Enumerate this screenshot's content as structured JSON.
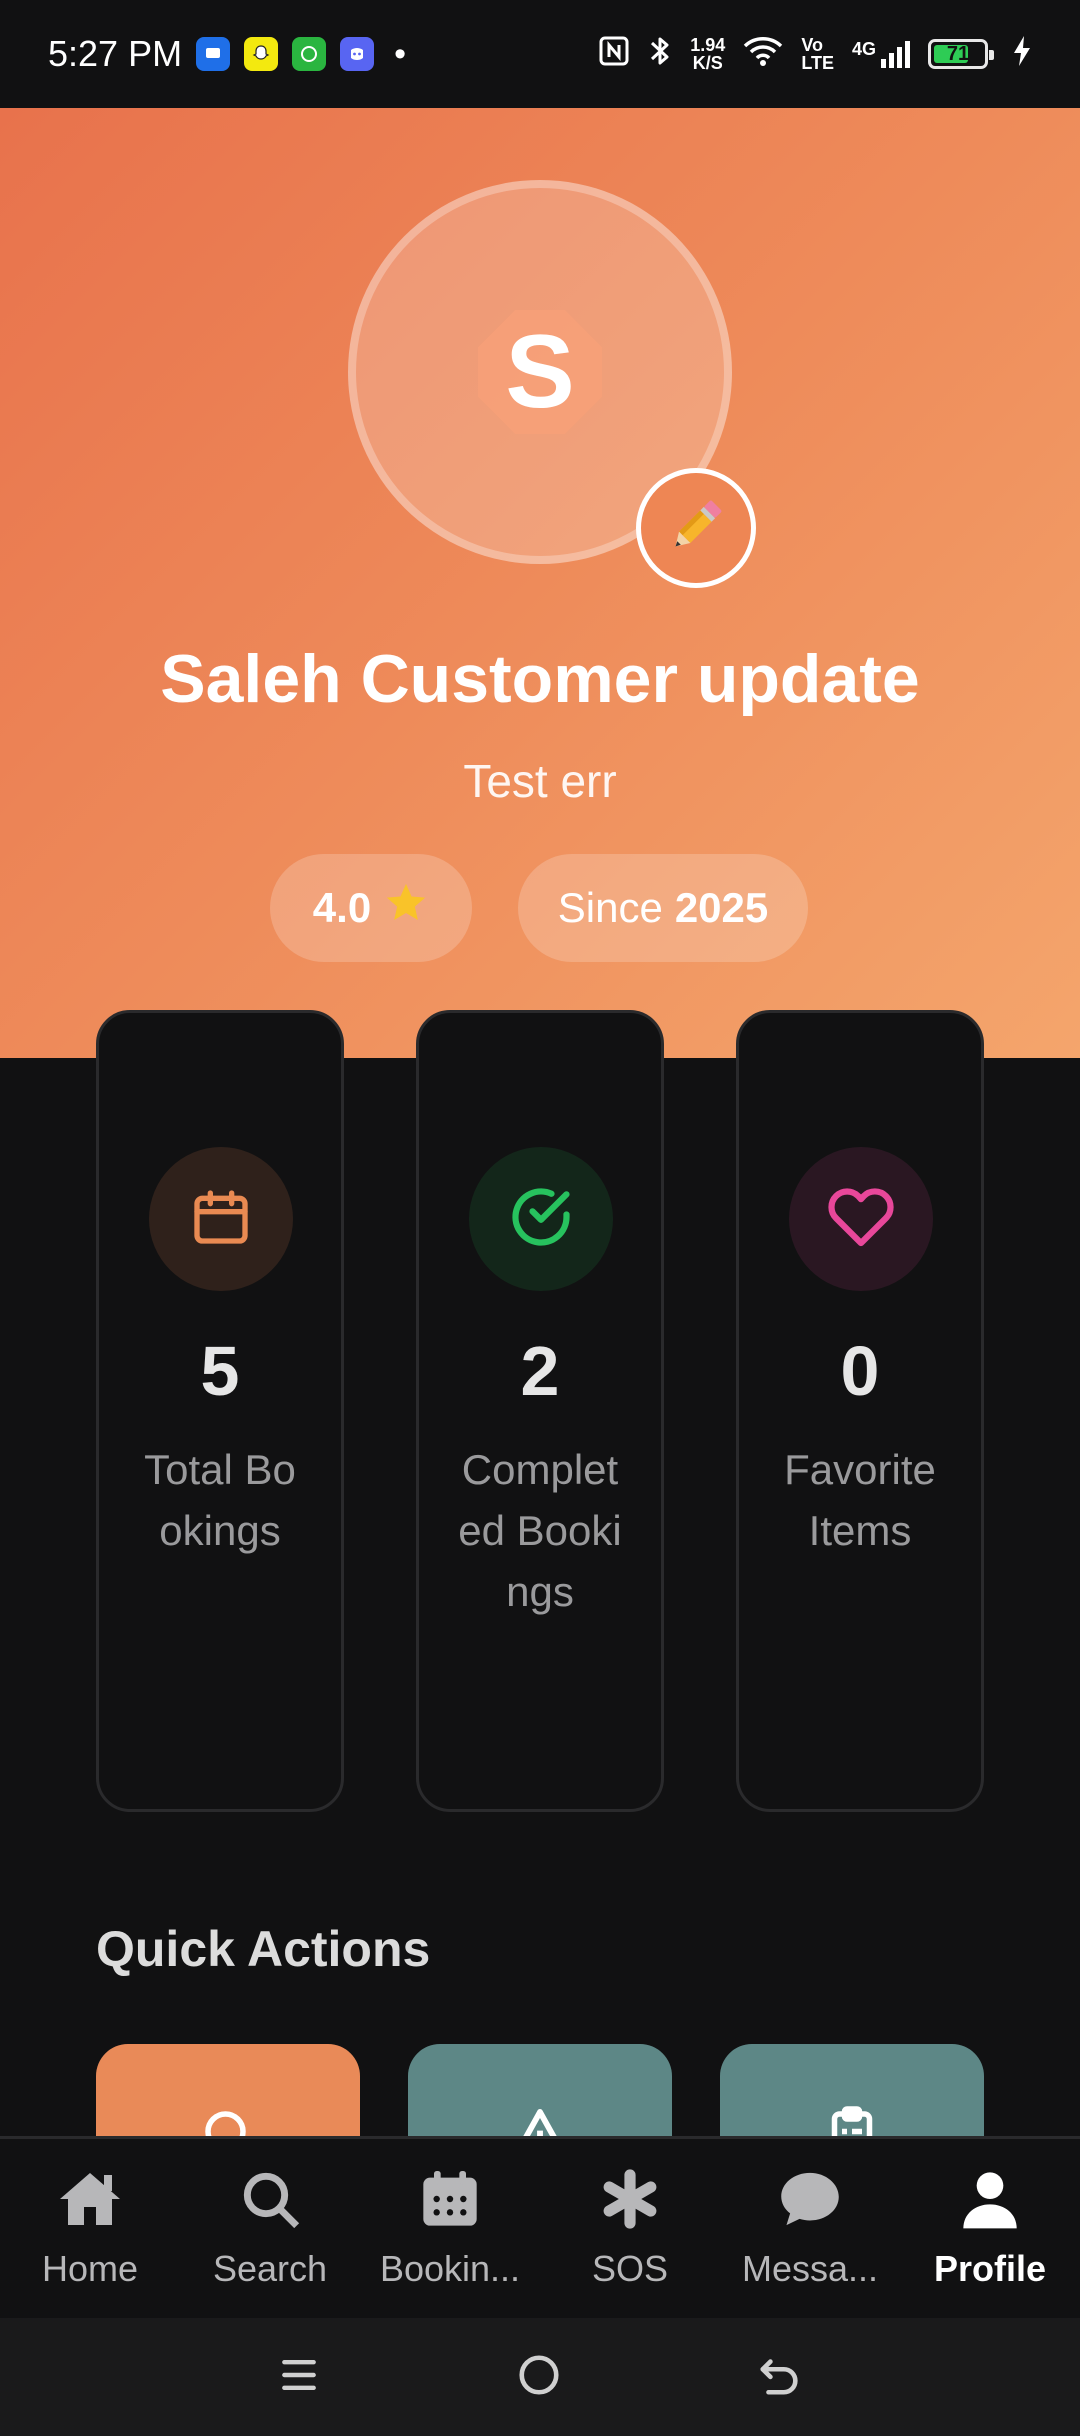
{
  "status_bar": {
    "time": "5:27 PM",
    "dot": "•",
    "net_speed_value": "1.94",
    "net_speed_unit": "K/S",
    "volte_top": "Vo",
    "volte_bottom": "LTE",
    "network": "4G",
    "battery_level": "71",
    "battery_fraction": 0.71
  },
  "profile": {
    "initial": "S",
    "name": "Saleh Customer update",
    "subtitle": "Test err",
    "rating": "4.0",
    "since_prefix": "Since",
    "since_year": "2025"
  },
  "stats": [
    {
      "value": "5",
      "label": "Total Bookings",
      "icon": "calendar-icon",
      "color": "#e98a52"
    },
    {
      "value": "2",
      "label": "Completed Bookings",
      "icon": "check-circle-icon",
      "color": "#27c25e"
    },
    {
      "value": "0",
      "label": "Favorite Items",
      "icon": "heart-icon",
      "color": "#e8479a"
    }
  ],
  "quick_actions": {
    "title": "Quick Actions",
    "tiles": [
      {
        "icon": "search-icon",
        "color": "#e98a58"
      },
      {
        "icon": "warning-icon",
        "color": "#5d8786"
      },
      {
        "icon": "clipboard-icon",
        "color": "#5d8786"
      }
    ]
  },
  "nav": {
    "items": [
      {
        "label": "Home",
        "icon": "home-icon"
      },
      {
        "label": "Search",
        "icon": "search-icon"
      },
      {
        "label": "Bookin...",
        "icon": "calendar-icon"
      },
      {
        "label": "SOS",
        "icon": "asterisk-icon"
      },
      {
        "label": "Messa...",
        "icon": "chat-icon"
      },
      {
        "label": "Profile",
        "icon": "user-icon",
        "active": true
      }
    ]
  },
  "colors": {
    "header_start": "#e8724c",
    "header_end": "#f4a56c",
    "background": "#111112",
    "accent": "#e98a52"
  }
}
